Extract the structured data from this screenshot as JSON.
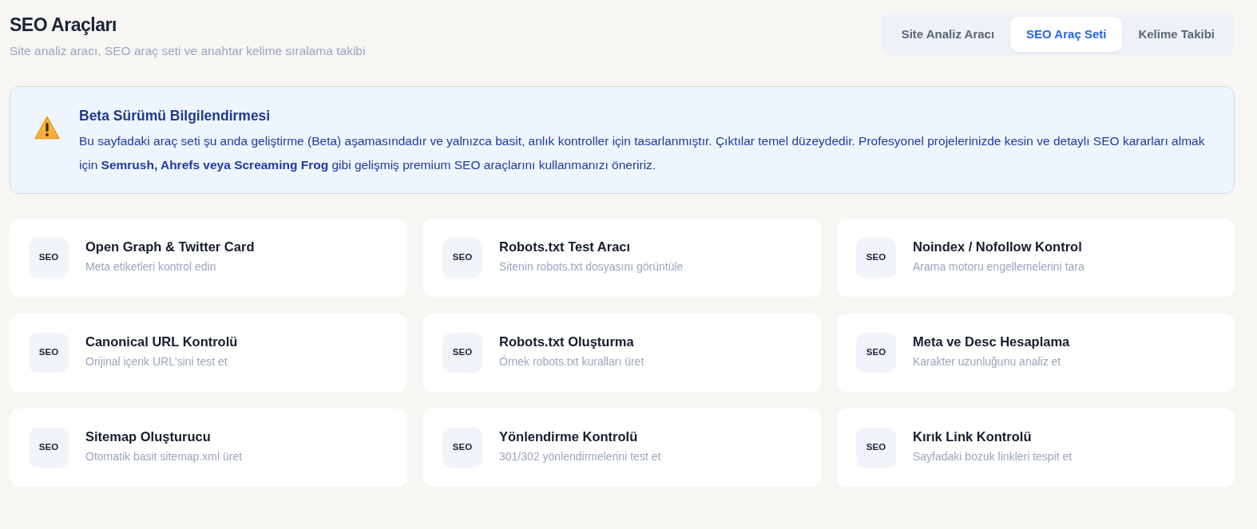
{
  "header": {
    "title": "SEO Araçları",
    "subtitle": "Site analiz aracı, SEO araç seti ve anahtar kelime sıralama takibi"
  },
  "tabs": [
    {
      "label": "Site Analiz Aracı",
      "selected": false
    },
    {
      "label": "SEO Araç Seti",
      "selected": true
    },
    {
      "label": "Kelime Takibi",
      "selected": false
    }
  ],
  "notice": {
    "title": "Beta Sürümü Bilgilendirmesi",
    "text": "Bu sayfadaki araç seti şu anda geliştirme (Beta) aşamasındadır ve yalnızca basit, anlık kontroller için tasarlanmıştır. Çıktılar temel düzeydedir. Profesyonel projelerinizde kesin ve detaylı SEO kararları almak için **Semrush, Ahrefs veya Screaming Frog** gibi gelişmiş premium SEO araçlarını kullanmanızı öneririz."
  },
  "tools": [
    {
      "badge": "SEO",
      "title": "Open Graph & Twitter Card",
      "description": "Meta etiketleri kontrol edin"
    },
    {
      "badge": "SEO",
      "title": "Robots.txt Test Aracı",
      "description": "Sitenin robots.txt dosyasını görüntüle"
    },
    {
      "badge": "SEO",
      "title": "Noindex / Nofollow Kontrol",
      "description": "Arama motoru engellemelerini tara"
    },
    {
      "badge": "SEO",
      "title": "Canonical URL Kontrolü",
      "description": "Orijinal içerik URL'sini test et"
    },
    {
      "badge": "SEO",
      "title": "Robots.txt Oluşturma",
      "description": "Örnek robots.txt kuralları üret"
    },
    {
      "badge": "SEO",
      "title": "Meta ve Desc Hesaplama",
      "description": "Karakter uzunluğunu analiz et"
    },
    {
      "badge": "SEO",
      "title": "Sitemap Oluşturucu",
      "description": "Otomatik basit sitemap.xml üret"
    },
    {
      "badge": "SEO",
      "title": "Yönlendirme Kontrolü",
      "description": "301/302 yönlendirmelerini test et"
    },
    {
      "badge": "SEO",
      "title": "Kırık Link Kontrolü",
      "description": "Sayfadaki bozuk linkleri tespit et"
    }
  ]
}
